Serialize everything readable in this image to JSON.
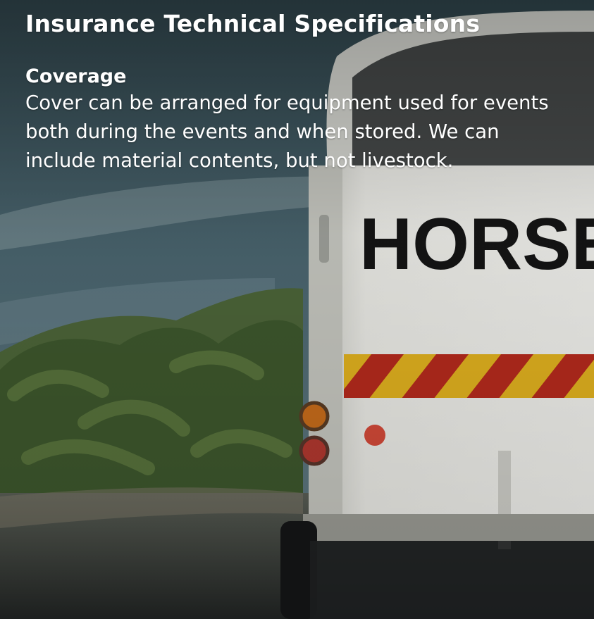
{
  "hero": {
    "image_alt": "Horse trailer parked on a gravel road beside green bushes under a cloudy sky",
    "trailer_sign": "HORSE"
  },
  "header": {
    "title": "Insurance Technical Specifications"
  },
  "section": {
    "heading": "Coverage",
    "body": "Cover can be arranged for equipment used for events both during the events and when stored. We can include material contents, but not livestock."
  },
  "colors": {
    "sky": "#3f5a63",
    "bushes": "#4c6a35",
    "trailer": "#e9e9e4",
    "sign_text": "#151515",
    "stripe_red": "#c42a1b",
    "stripe_yellow": "#e8b51a",
    "text": "#ffffff"
  },
  "icons": {
    "tail_lights": "round-lamp-shape",
    "reflector": "red-circle"
  }
}
